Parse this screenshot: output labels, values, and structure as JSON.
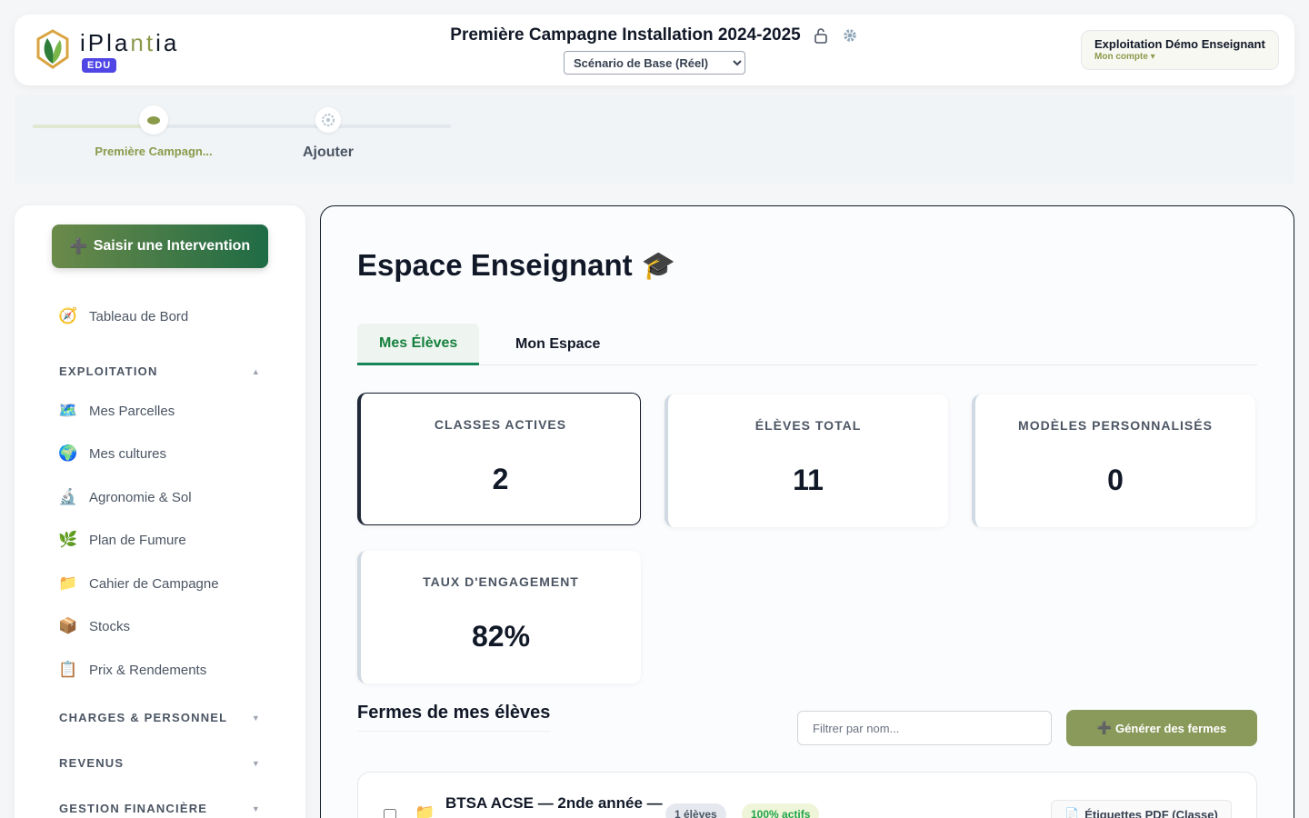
{
  "header": {
    "logo_name": "iPlantia",
    "logo_badge": "EDU",
    "campaign_title": "Première Campagne Installation 2024-2025",
    "scenario_options": [
      "Scénario de Base (Réel)"
    ],
    "scenario_selected": "Scénario de Base (Réel)",
    "account_name": "Exploitation Démo Enseignant",
    "account_sub": "Mon compte ▾"
  },
  "stepper": {
    "steps": [
      {
        "label": "Première Campagn..."
      },
      {
        "label": "Ajouter"
      }
    ]
  },
  "sidebar": {
    "cta_label": "Saisir une Intervention",
    "dashboard": "Tableau de Bord",
    "sections": {
      "exploitation": "EXPLOITATION",
      "charges": "CHARGES & PERSONNEL",
      "revenus": "REVENUS",
      "gestion": "GESTION FINANCIÈRE"
    },
    "items": [
      {
        "label": "Mes Parcelles",
        "icon": "🗺️"
      },
      {
        "label": "Mes cultures",
        "icon": "🌍"
      },
      {
        "label": "Agronomie & Sol",
        "icon": "🔬"
      },
      {
        "label": "Plan de Fumure",
        "icon": "🌿"
      },
      {
        "label": "Cahier de Campagne",
        "icon": "📁"
      },
      {
        "label": "Stocks",
        "icon": "📦"
      },
      {
        "label": "Prix & Rendements",
        "icon": "📋"
      }
    ]
  },
  "main": {
    "title": "Espace Enseignant",
    "title_icon": "🎓",
    "tabs": [
      {
        "label": "Mes Élèves"
      },
      {
        "label": "Mon Espace"
      }
    ],
    "stats": [
      {
        "label": "CLASSES ACTIVES",
        "value": "2"
      },
      {
        "label": "ÉLÈVES TOTAL",
        "value": "11"
      },
      {
        "label": "MODÈLES PERSONNALISÉS",
        "value": "0"
      },
      {
        "label": "TAUX D'ENGAGEMENT",
        "value": "82%"
      }
    ],
    "section_title": "Fermes de mes élèves",
    "filter_placeholder": "Filtrer par nom...",
    "generate_label": "Générer des fermes",
    "class_card": {
      "name": "BTSA ACSE — 2nde année —",
      "students_badge": "1 élèves",
      "active_badge": "100% actifs",
      "pdf_label": "Étiquettes PDF (Classe)"
    }
  }
}
